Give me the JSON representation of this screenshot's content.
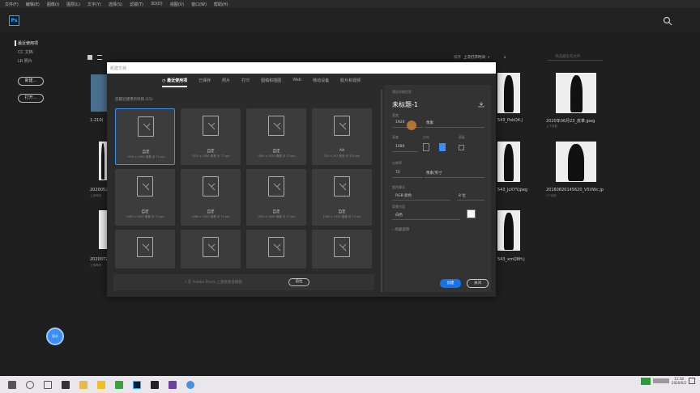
{
  "menu": [
    "文件(F)",
    "编辑(E)",
    "图像(I)",
    "图层(L)",
    "文字(Y)",
    "选择(S)",
    "滤镜(T)",
    "3D(D)",
    "视图(V)",
    "窗口(W)",
    "帮助(H)"
  ],
  "app": {
    "logo": "Ps",
    "accent": "#31a8ff"
  },
  "home": {
    "nav": [
      "最近使用项",
      "CC 文档",
      "LR 照片"
    ],
    "new_btn": "新建...",
    "open_btn": "打开...",
    "sort_label": "排序",
    "sort_value": "上次打开时间",
    "filter_placeholder": "筛选最近的文件",
    "bg_files": [
      {
        "name": "1-210(",
        "sub": ""
      },
      {
        "name": "2020052",
        "sub": "上传时间"
      },
      {
        "name": "2020072",
        "sub": "上传时间"
      },
      {
        "name": "543_PokQ4.j",
        "sub": ""
      },
      {
        "name": "2020年06月23_皮革.jpeg",
        "sub": "上个月前"
      },
      {
        "name": "543_JzXYY.jpeg",
        "sub": ""
      },
      {
        "name": "20160820145620_V5VWc.jp",
        "sub": "2个月前"
      },
      {
        "name": "543_xmQ8H.j",
        "sub": ""
      }
    ]
  },
  "dialog": {
    "title": "新建文档",
    "tabs": [
      "最近使用项",
      "已保存",
      "照片",
      "打印",
      "图稿和插图",
      "Web",
      "移动设备",
      "胶片和视频"
    ],
    "recent_label": "您最近使用的项目 (15)",
    "cards": [
      {
        "name": "自定",
        "dims": "1920 x 1080 像素 @ 72 ppi"
      },
      {
        "name": "自定",
        "dims": "1920 x 1080 像素 @ 72 ppi"
      },
      {
        "name": "自定",
        "dims": "1080 x 1920 像素 @ 72 ppi"
      },
      {
        "name": "A4",
        "dims": "210 x 297 毫米 @ 300 ppi"
      },
      {
        "name": "自定",
        "dims": "1080 x 1920 像素 @ 72 ppi"
      },
      {
        "name": "自定",
        "dims": "1080 x 1920 像素 @ 72 ppi"
      },
      {
        "name": "自定",
        "dims": "1920 x 1080 像素 @ 72 ppi"
      },
      {
        "name": "自定",
        "dims": "1080 x 1920 像素 @ 72 ppi"
      },
      {
        "name": "",
        "dims": ""
      },
      {
        "name": "",
        "dims": ""
      },
      {
        "name": "",
        "dims": ""
      },
      {
        "name": "",
        "dims": ""
      }
    ],
    "find_text": "在 Adobe Stock 上查找更多模板",
    "go_btn": "前往",
    "presets": {
      "heading": "预设详细信息",
      "doc_name": "未标题-1",
      "width_label": "宽度",
      "width_value": "1920",
      "width_unit": "像素",
      "height_label": "高度",
      "height_value": "1080",
      "orient_label": "方向",
      "art_label": "画板",
      "res_label": "分辨率",
      "res_value": "72",
      "res_unit": "像素/英寸",
      "mode_label": "颜色模式",
      "mode_value": "RGB 颜色",
      "bit_value": "8 位",
      "bg_label": "背景内容",
      "bg_value": "白色",
      "advanced": "高级选项"
    },
    "create_btn": "创建",
    "close_btn": "关闭"
  },
  "avatar": "设计",
  "tray": {
    "time": "11:18",
    "date": "2020/6/2"
  }
}
